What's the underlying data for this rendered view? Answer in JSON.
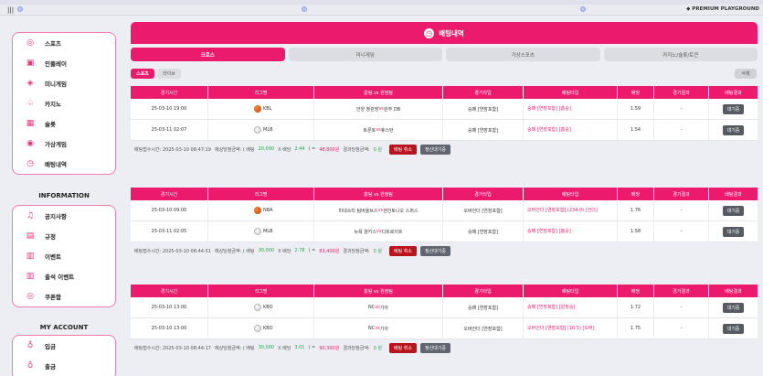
{
  "topbar": {
    "menu_icon": "|||",
    "premium_label": "◆ PREMIUM PLAYGROUND"
  },
  "sidebar": {
    "main_items": [
      {
        "icon": "soccer-icon",
        "glyph": "◎",
        "label": "스포츠"
      },
      {
        "icon": "inplay-icon",
        "glyph": "▣",
        "label": "인플레이"
      },
      {
        "icon": "minigame-icon",
        "glyph": "◈",
        "label": "미니게임"
      },
      {
        "icon": "casino-icon",
        "glyph": "♤",
        "label": "카지노"
      },
      {
        "icon": "slot-icon",
        "glyph": "▦",
        "label": "슬롯"
      },
      {
        "icon": "virtual-game-icon",
        "glyph": "◉",
        "label": "가상게임"
      },
      {
        "icon": "bet-history-icon",
        "glyph": "◷",
        "label": "배팅내역"
      }
    ],
    "info_title": "INFORMATION",
    "info_items": [
      {
        "icon": "bell-icon",
        "glyph": "♫",
        "label": "공지사항"
      },
      {
        "icon": "rules-icon",
        "glyph": "▤",
        "label": "규정"
      },
      {
        "icon": "gift-icon",
        "glyph": "▥",
        "label": "이벤트"
      },
      {
        "icon": "gift-icon",
        "glyph": "▥",
        "label": "출석 이벤트"
      },
      {
        "icon": "coupon-icon",
        "glyph": "◎",
        "label": "쿠폰함"
      }
    ],
    "account_title": "MY ACCOUNT",
    "account_items": [
      {
        "icon": "deposit-icon",
        "glyph": "♁",
        "label": "입금"
      },
      {
        "icon": "withdraw-icon",
        "glyph": "♁",
        "label": "출금"
      }
    ]
  },
  "page": {
    "title": "배팅내역",
    "tabs": [
      "크로스",
      "미니게임",
      "가상스포츠",
      "카지노/슬롯/토큰"
    ],
    "subtabs": [
      "스포츠",
      "라이브"
    ],
    "delete_label": "삭제",
    "columns": [
      "경기시간",
      "리그명",
      "홈팀 vs 원정팀",
      "경기타입",
      "배팅타입",
      "배당",
      "경기결과",
      "배팅결과"
    ]
  },
  "bets": [
    {
      "rows": [
        {
          "time": "25-03-10 19:00",
          "ball": "bb",
          "league": "KBL",
          "home": "안양 정관장",
          "away": "원주 DB",
          "type": "승패 [연장포함]",
          "pick": "승패 [연장포함] [홈승]",
          "odds": "1.59",
          "result": "-",
          "status": "대기중"
        },
        {
          "time": "25-03-11 02:07",
          "ball": "base",
          "league": "MLB",
          "home": "토론토",
          "away": "휴스턴",
          "type": "승패 [연장포함]",
          "pick": "승패 [연장포함] [홈승]",
          "odds": "1.54",
          "result": "-",
          "status": "대기중"
        }
      ],
      "summary": {
        "time_label": "배팅접수시간: 2025-03-10 08:47:19",
        "exp_label": "예상당첨금액: ( 배팅",
        "stake": "20,000",
        "x1": "X 배당",
        "odds": "2.44",
        "eq": ") =",
        "win": "48,800원",
        "res_label": "결과당첨금액:",
        "res": "0 원",
        "cancel": "배팅 취소",
        "settle": "정산대기중"
      }
    },
    {
      "rows": [
        {
          "time": "25-03-10 09:00",
          "ball": "bb",
          "league": "NBA",
          "home": "미네소타 팀버울브스",
          "away": "샌안토니오 스퍼스",
          "type": "오버언더 [연장포함]",
          "pick": "오버언더 [연장포함] (234.0) [언더]",
          "odds": "1.76",
          "result": "-",
          "status": "대기중"
        },
        {
          "time": "25-03-11 02:05",
          "ball": "base",
          "league": "MLB",
          "home": "뉴욕 양키스",
          "away": "디트로이트",
          "type": "승패 [연장포함]",
          "pick": "승패 [연장포함] [홈승]",
          "odds": "1.58",
          "result": "-",
          "status": "대기중"
        }
      ],
      "summary": {
        "time_label": "배팅접수시간: 2025-03-10 08:44:51",
        "exp_label": "예상당첨금액: ( 배팅",
        "stake": "30,000",
        "x1": "X 배당",
        "odds": "2.78",
        "eq": ") =",
        "win": "83,400원",
        "res_label": "결과당첨금액:",
        "res": "0 원",
        "cancel": "배팅 취소",
        "settle": "정산대기중"
      }
    },
    {
      "rows": [
        {
          "time": "25-03-10 13:00",
          "ball": "base",
          "league": "KBO",
          "home": "NC",
          "away": "기아",
          "type": "승패 [연장포함]",
          "pick": "승패 [연장포함] [원정승]",
          "odds": "1.72",
          "result": "-",
          "status": "대기중"
        },
        {
          "time": "25-03-10 13:00",
          "ball": "base",
          "league": "KBO",
          "home": "NC",
          "away": "기아",
          "type": "오버언더 [연장포함]",
          "pick": "오버언더 [연장포함] (10.5) [오버]",
          "odds": "1.75",
          "result": "-",
          "status": "대기중"
        }
      ],
      "summary": {
        "time_label": "배팅접수시간: 2025-03-10 08:44:17",
        "exp_label": "예상당첨금액: ( 배팅",
        "stake": "30,000",
        "x1": "X 배당",
        "odds": "3.01",
        "eq": ") =",
        "win": "90,300원",
        "res_label": "결과당첨금액:",
        "res": "0 원",
        "cancel": "배팅 취소",
        "settle": "정산대기중"
      }
    }
  ]
}
